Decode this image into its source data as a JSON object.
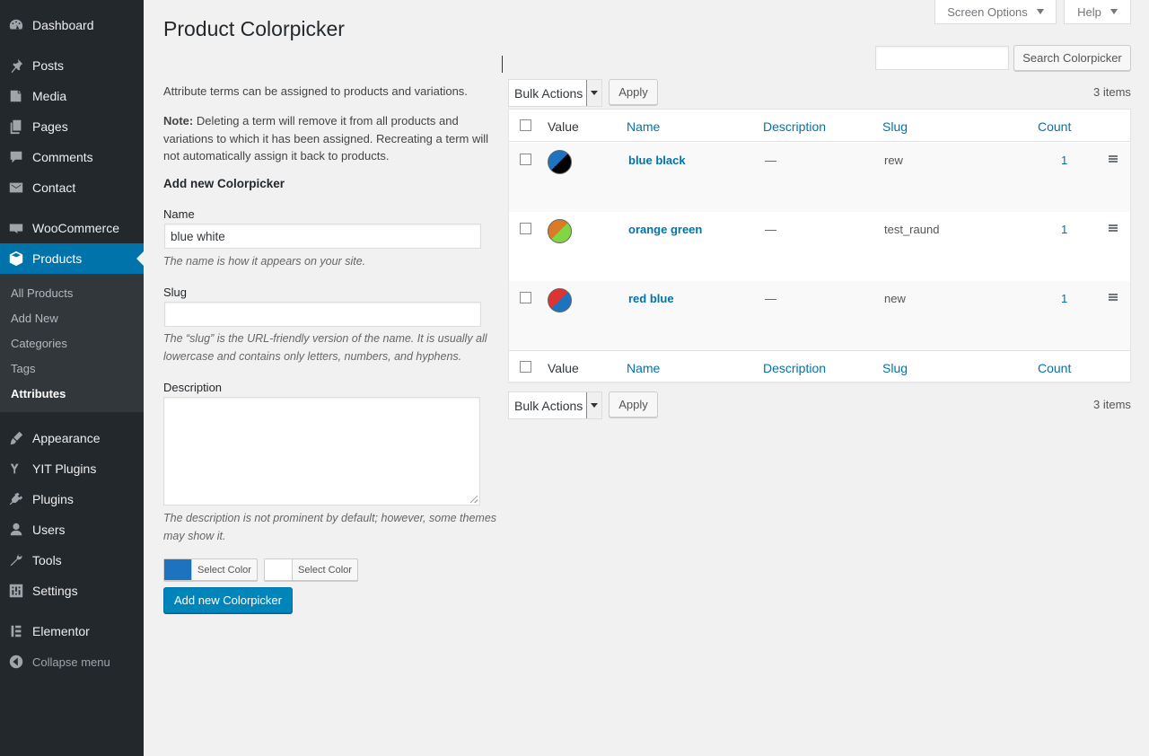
{
  "sidebar": {
    "items": [
      {
        "label": "Dashboard",
        "icon": "dashboard-icon"
      },
      {
        "label": "Posts",
        "icon": "pin-icon"
      },
      {
        "label": "Media",
        "icon": "media-icon"
      },
      {
        "label": "Pages",
        "icon": "pages-icon"
      },
      {
        "label": "Comments",
        "icon": "comment-icon"
      },
      {
        "label": "Contact",
        "icon": "mail-icon"
      },
      {
        "label": "WooCommerce",
        "icon": "woocommerce-icon"
      },
      {
        "label": "Products",
        "icon": "box-icon"
      },
      {
        "label": "Appearance",
        "icon": "brush-icon"
      },
      {
        "label": "YIT Plugins",
        "icon": "yit-icon"
      },
      {
        "label": "Plugins",
        "icon": "plug-icon"
      },
      {
        "label": "Users",
        "icon": "user-icon"
      },
      {
        "label": "Tools",
        "icon": "wrench-icon"
      },
      {
        "label": "Settings",
        "icon": "settings-icon"
      },
      {
        "label": "Elementor",
        "icon": "elementor-icon"
      }
    ],
    "submenu": [
      "All Products",
      "Add New",
      "Categories",
      "Tags",
      "Attributes"
    ],
    "collapse_label": "Collapse menu"
  },
  "top": {
    "screen_options": "Screen Options",
    "help": "Help"
  },
  "page_title": "Product Colorpicker",
  "form": {
    "intro": "Attribute terms can be assigned to products and variations.",
    "note_label": "Note:",
    "note_text": " Deleting a term will remove it from all products and variations to which it has been assigned. Recreating a term will not automatically assign it back to products.",
    "heading": "Add new Colorpicker",
    "name_label": "Name",
    "name_value": "blue white",
    "name_help": "The name is how it appears on your site.",
    "slug_label": "Slug",
    "slug_value": "",
    "slug_help": "The “slug” is the URL-friendly version of the name. It is usually all lowercase and contains only letters, numbers, and hyphens.",
    "description_label": "Description",
    "description_help": "The description is not prominent by default; however, some themes may show it.",
    "color_buttons": [
      {
        "label": "Select Color",
        "color": "#1e73be"
      },
      {
        "label": "Select Color",
        "color": "#ffffff"
      }
    ],
    "submit_label": "Add new Colorpicker"
  },
  "list": {
    "search_button": "Search Colorpicker",
    "bulk_actions": "Bulk Actions",
    "apply": "Apply",
    "items_count": "3 items",
    "columns": {
      "value": "Value",
      "name": "Name",
      "description": "Description",
      "slug": "Slug",
      "count": "Count"
    },
    "rows": [
      {
        "name": "blue black",
        "description": "—",
        "slug": "rew",
        "count": "1",
        "color1": "#1e73be",
        "color2": "#000000"
      },
      {
        "name": "orange green",
        "description": "—",
        "slug": "test_raund",
        "count": "1",
        "color1": "#dd7a26",
        "color2": "#81d742"
      },
      {
        "name": "red blue",
        "description": "—",
        "slug": "new",
        "count": "1",
        "color1": "#dd3333",
        "color2": "#1e73be"
      }
    ]
  },
  "colors": {
    "sidebar_bg": "#23282d",
    "submenu_bg": "#32373c",
    "accent": "#0073aa",
    "primary_button": "#0085ba"
  }
}
